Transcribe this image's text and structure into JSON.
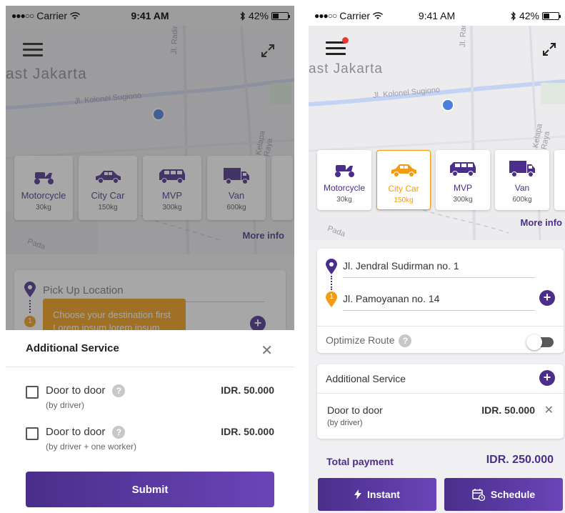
{
  "status_bar": {
    "carrier": "Carrier",
    "time": "9:41 AM",
    "battery": "42%",
    "battery_level": 0.42
  },
  "map": {
    "city": "ast Jakarta",
    "roads": [
      "Jl. Kolonel Sugiono",
      "Jl. Radin Inten II",
      "Kelapa Raya",
      "Pada"
    ]
  },
  "vehicles": [
    {
      "name": "Motorcycle",
      "capacity": "30kg"
    },
    {
      "name": "City Car",
      "capacity": "150kg"
    },
    {
      "name": "MVP",
      "capacity": "300kg"
    },
    {
      "name": "Van",
      "capacity": "600kg"
    }
  ],
  "more_info": "More info",
  "screen_a": {
    "pickup_placeholder": "Pick Up Location",
    "marker_number": "1",
    "tooltip": "Choose your destination first\nLorem ipsum lorem ipsum",
    "sheet_title": "Additional Service",
    "services": [
      {
        "name": "Door to door",
        "sub": "(by driver)",
        "price": "IDR. 50.000",
        "checked": false
      },
      {
        "name": "Door to door",
        "sub": "(by driver + one worker)",
        "price": "IDR. 50.000",
        "checked": false
      }
    ],
    "submit_label": "Submit"
  },
  "screen_b": {
    "pickup": "Jl. Jendral Sudirman no. 1",
    "marker_number": "1",
    "destination": "Jl. Pamoyanan no. 14",
    "optimize_label": "Optimize Route",
    "optimize_on": false,
    "additional_title": "Additional Service",
    "service": {
      "name": "Door to door",
      "sub": "(by driver)",
      "price": "IDR. 50.000"
    },
    "total_label": "Total payment",
    "total_value": "IDR. 250.000",
    "instant_label": "Instant",
    "schedule_label": "Schedule"
  },
  "colors": {
    "primary": "#4a2e8a",
    "accent": "#f39c12",
    "map_bg": "#ececef"
  },
  "icons": [
    "hamburger-icon",
    "expand-icon",
    "motorcycle-icon",
    "car-icon",
    "minivan-icon",
    "van-icon",
    "pin-icon",
    "plus-icon",
    "close-icon",
    "question-icon",
    "lightning-icon",
    "calendar-clock-icon",
    "wifi-icon",
    "bluetooth-icon",
    "battery-icon"
  ]
}
